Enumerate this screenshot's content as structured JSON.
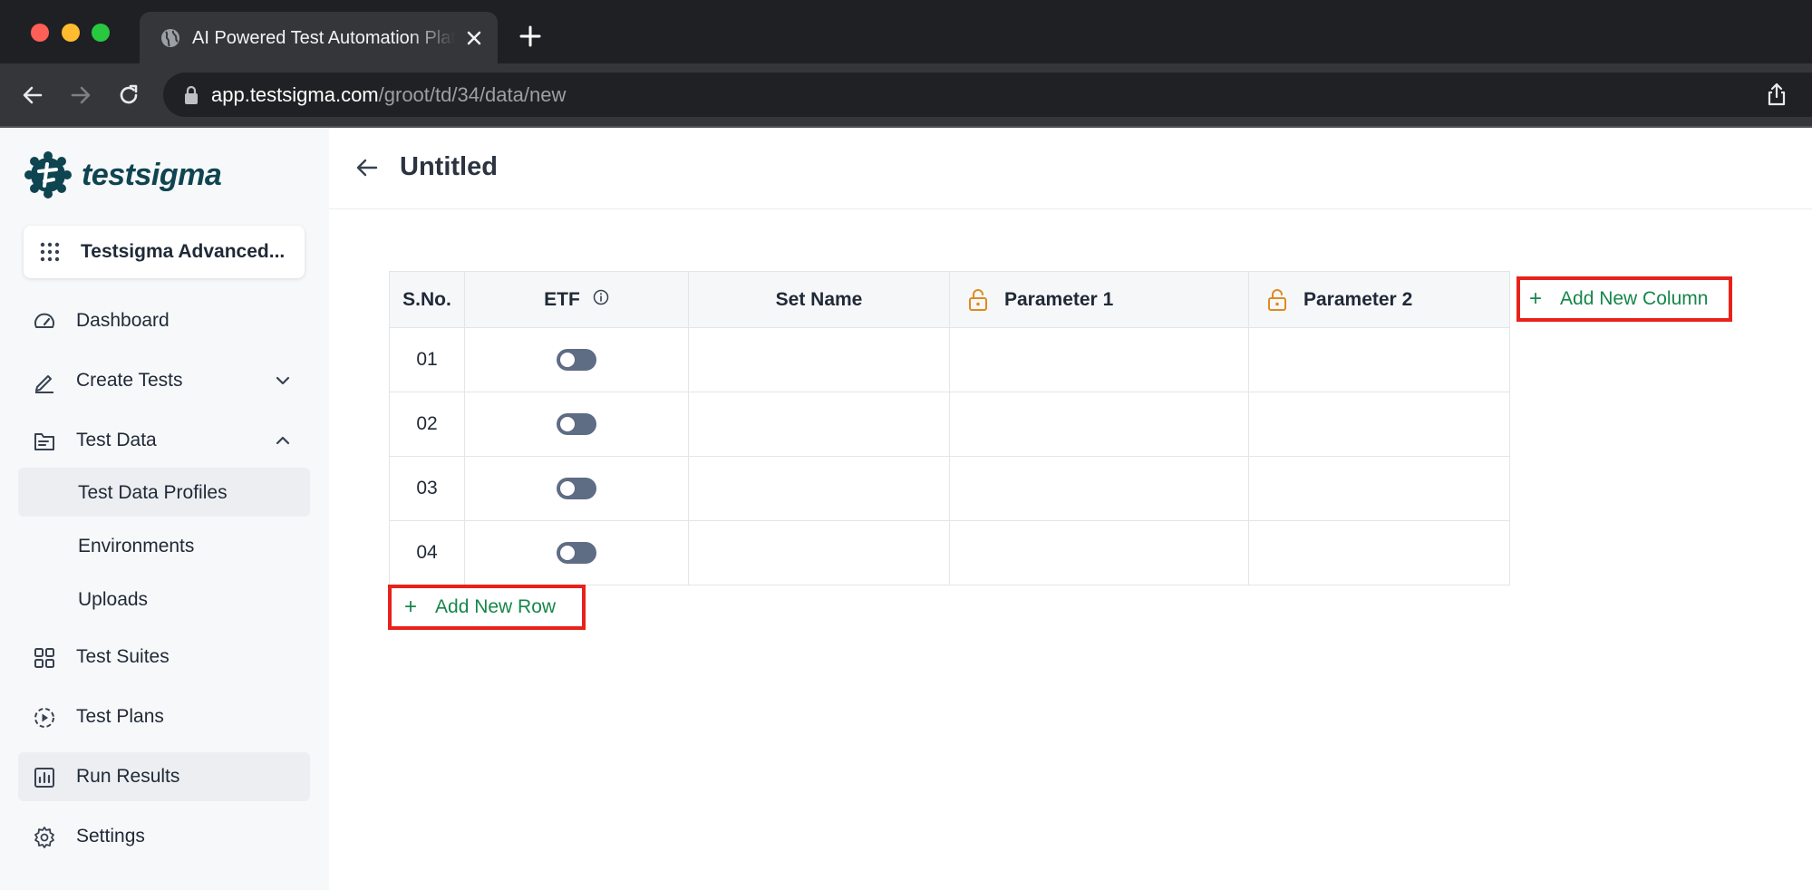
{
  "browser": {
    "tab_title": "AI Powered Test Automation Platform",
    "url_host": "app.testsigma.com",
    "url_path": "/groot/td/34/data/new"
  },
  "sidebar": {
    "logo_text": "testsigma",
    "workspace": "Testsigma Advanced...",
    "items": [
      {
        "label": "Dashboard",
        "icon": "gauge-icon"
      },
      {
        "label": "Create Tests",
        "icon": "pencil-icon",
        "chevron": "down"
      },
      {
        "label": "Test Data",
        "icon": "folder-icon",
        "chevron": "up"
      },
      {
        "label": "Test Suites",
        "icon": "grid-icon"
      },
      {
        "label": "Test Plans",
        "icon": "play-circle-icon"
      },
      {
        "label": "Run Results",
        "icon": "bar-chart-icon"
      },
      {
        "label": "Settings",
        "icon": "gear-icon"
      }
    ],
    "sub_items": [
      "Test Data Profiles",
      "Environments",
      "Uploads"
    ]
  },
  "main": {
    "title": "Untitled",
    "table": {
      "headers": [
        "S.No.",
        "ETF",
        "Set Name",
        "Parameter 1",
        "Parameter 2"
      ],
      "rows": [
        {
          "sno": "01",
          "set_name": "",
          "param1": "",
          "param2": ""
        },
        {
          "sno": "02",
          "set_name": "",
          "param1": "",
          "param2": ""
        },
        {
          "sno": "03",
          "set_name": "",
          "param1": "",
          "param2": ""
        },
        {
          "sno": "04",
          "set_name": "",
          "param1": "",
          "param2": ""
        }
      ]
    },
    "add_column_label": "Add New Column",
    "add_row_label": "Add New Row",
    "highlight_color": "#e8221b",
    "accent_color": "#16864a"
  }
}
